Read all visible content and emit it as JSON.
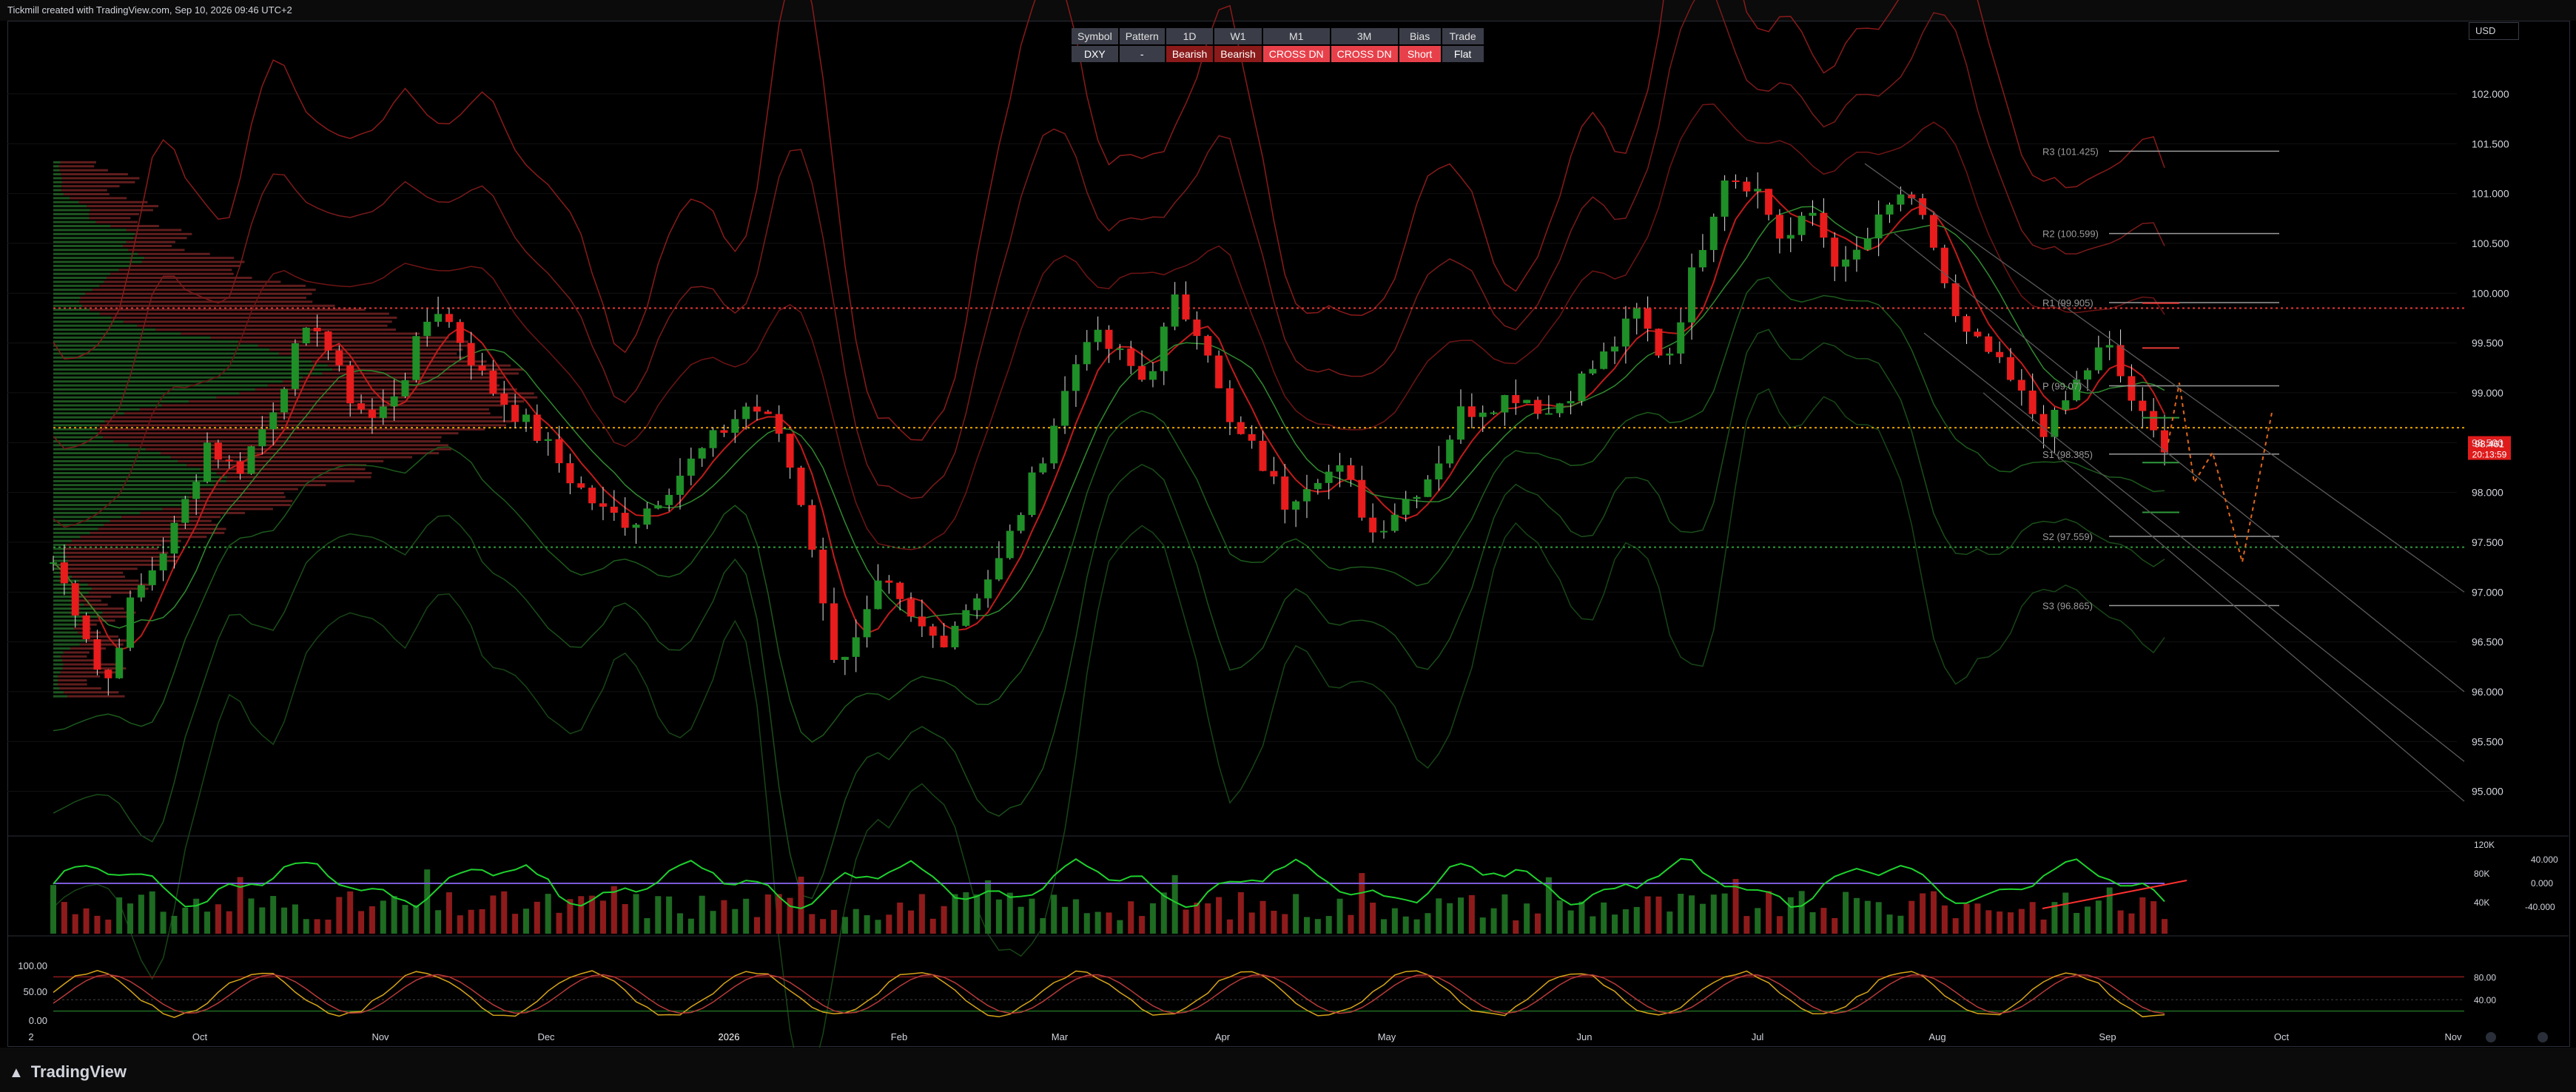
{
  "header": {
    "credit": "Tickmill created with TradingView.com, Sep 10, 2026 09:46 UTC+2",
    "currency": "USD"
  },
  "footer": {
    "brand": "TradingView",
    "logo_icon": "tradingview-logo-icon"
  },
  "status_table": {
    "headers": [
      "Symbol",
      "Pattern",
      "1D",
      "W1",
      "M1",
      "3M",
      "Bias",
      "Trade"
    ],
    "values": [
      {
        "text": "DXY",
        "color": "#3a3d48"
      },
      {
        "text": "-",
        "color": "#3a3d48"
      },
      {
        "text": "Bearish",
        "color": "#8b1a1a"
      },
      {
        "text": "Bearish",
        "color": "#8b1a1a"
      },
      {
        "text": "CROSS DN",
        "color": "#e8404a"
      },
      {
        "text": "CROSS DN",
        "color": "#e8404a"
      },
      {
        "text": "Short",
        "color": "#e8404a"
      },
      {
        "text": "Flat",
        "color": "#3a3d48"
      }
    ]
  },
  "colors": {
    "bull": "#1f8f27",
    "bear": "#e81c1c",
    "grid": "#1a1a1a",
    "axis_text": "#d1d4dc"
  },
  "chart_data": [
    {
      "type": "candlestick",
      "ylim": [
        94.7,
        102.2
      ],
      "y_ticks": [
        "102.000",
        "101.500",
        "101.000",
        "100.500",
        "100.000",
        "99.500",
        "99.000",
        "98.500",
        "98.000",
        "97.500",
        "97.000",
        "96.500",
        "96.000",
        "95.500",
        "95.000"
      ],
      "x_ticks": [
        "2",
        "Oct",
        "Nov",
        "Dec",
        "2026",
        "Feb",
        "Mar",
        "Apr",
        "May",
        "Jun",
        "Jul",
        "Aug",
        "Sep",
        "Oct",
        "Nov"
      ],
      "price_label": {
        "value": "98.461",
        "timer": "20:13:59"
      },
      "pivots": [
        {
          "label": "R3 (101.425)",
          "value": 101.425
        },
        {
          "label": "R2 (100.599)",
          "value": 100.599
        },
        {
          "label": "R1 (99.905)",
          "value": 99.905
        },
        {
          "label": "P (99.07)",
          "value": 99.07
        },
        {
          "label": "S1 (98.385)",
          "value": 98.385
        },
        {
          "label": "S2 (97.559)",
          "value": 97.559
        },
        {
          "label": "S3 (96.865)",
          "value": 96.865
        }
      ],
      "levels": [
        99.85,
        98.65,
        97.45
      ],
      "path": [
        [
          0,
          97.3
        ],
        [
          8,
          96.7
        ],
        [
          14,
          96.0
        ],
        [
          20,
          96.8
        ],
        [
          28,
          97.3
        ],
        [
          34,
          97.7
        ],
        [
          42,
          98.5
        ],
        [
          50,
          98.2
        ],
        [
          58,
          98.7
        ],
        [
          66,
          99.4
        ],
        [
          72,
          99.7
        ],
        [
          80,
          99.0
        ],
        [
          88,
          98.7
        ],
        [
          96,
          99.2
        ],
        [
          104,
          99.9
        ],
        [
          110,
          99.6
        ],
        [
          118,
          99.1
        ],
        [
          126,
          98.8
        ],
        [
          134,
          98.5
        ],
        [
          142,
          98.1
        ],
        [
          150,
          97.8
        ],
        [
          158,
          97.7
        ],
        [
          166,
          98.0
        ],
        [
          174,
          98.3
        ],
        [
          182,
          98.6
        ],
        [
          190,
          98.9
        ],
        [
          198,
          98.6
        ],
        [
          206,
          97.7
        ],
        [
          212,
          96.4
        ],
        [
          218,
          96.4
        ],
        [
          226,
          97.1
        ],
        [
          234,
          96.7
        ],
        [
          242,
          96.5
        ],
        [
          250,
          96.9
        ],
        [
          258,
          97.3
        ],
        [
          266,
          98.0
        ],
        [
          274,
          98.8
        ],
        [
          282,
          99.6
        ],
        [
          290,
          99.4
        ],
        [
          298,
          99.1
        ],
        [
          306,
          99.9
        ],
        [
          314,
          99.6
        ],
        [
          320,
          98.7
        ],
        [
          328,
          98.4
        ],
        [
          336,
          97.9
        ],
        [
          344,
          98.2
        ],
        [
          352,
          98.2
        ],
        [
          360,
          97.6
        ],
        [
          368,
          97.9
        ],
        [
          376,
          98.2
        ],
        [
          384,
          98.8
        ],
        [
          392,
          98.9
        ],
        [
          400,
          99.0
        ],
        [
          408,
          98.8
        ],
        [
          416,
          99.1
        ],
        [
          424,
          99.4
        ],
        [
          432,
          99.8
        ],
        [
          440,
          99.3
        ],
        [
          448,
          100.3
        ],
        [
          456,
          101.2
        ],
        [
          464,
          101.1
        ],
        [
          472,
          100.5
        ],
        [
          480,
          100.8
        ],
        [
          488,
          100.2
        ],
        [
          496,
          100.6
        ],
        [
          504,
          101.0
        ],
        [
          512,
          100.6
        ],
        [
          520,
          99.6
        ],
        [
          528,
          99.4
        ],
        [
          536,
          99.0
        ],
        [
          544,
          98.6
        ],
        [
          552,
          99.1
        ],
        [
          560,
          99.5
        ],
        [
          566,
          99.0
        ],
        [
          572,
          98.6
        ],
        [
          576,
          98.5
        ]
      ]
    },
    {
      "type": "bar",
      "name": "volume",
      "ytick": [
        "120K",
        "80K",
        "40K"
      ],
      "osc_ticks": [
        "40.000",
        "0.000",
        "-40.000"
      ]
    },
    {
      "type": "line",
      "name": "stochastic",
      "ytick_left": [
        "100.00",
        "50.00",
        "0.00"
      ],
      "ytick_right": [
        "80.00",
        "40.00"
      ]
    }
  ]
}
